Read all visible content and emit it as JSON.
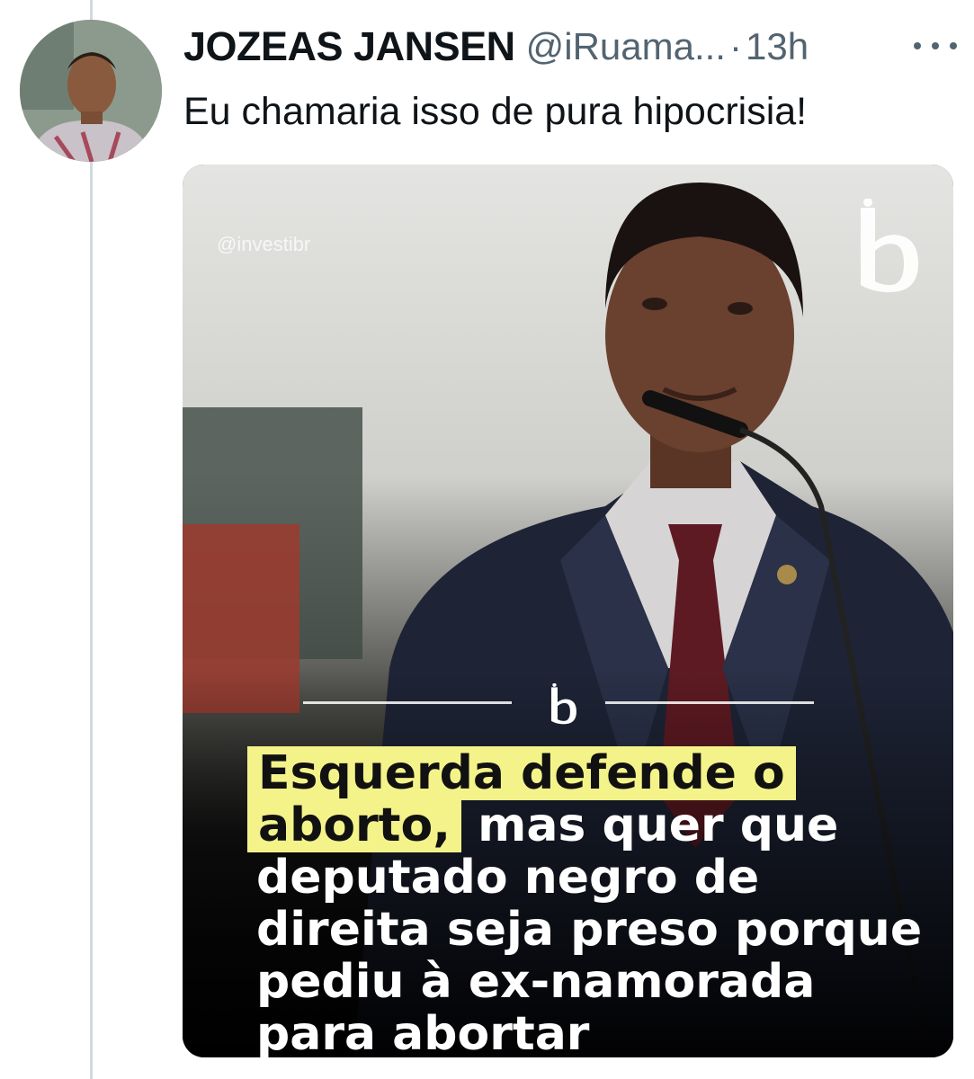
{
  "tweet": {
    "display_name": "JOZEAS JANSEN",
    "handle": "@iRuama...",
    "separator": "·",
    "time": "13h",
    "text": "Eu chamaria isso de pura hipocrisia!"
  },
  "media": {
    "watermark": "@investibr",
    "headline": {
      "line1_highlight": "Esquerda defende o",
      "line2_highlight": "aborto,",
      "line2_rest": " mas quer que",
      "line3": "deputado negro de",
      "line4": "direita seja preso porque",
      "line5": "pediu à ex-namorada",
      "line6": "para abortar"
    }
  },
  "colors": {
    "text_primary": "#0f1419",
    "text_secondary": "#536471",
    "thread_line": "#cfd9de",
    "highlight": "#f4f38a"
  },
  "icons": [
    "more-icon",
    "brand-logo",
    "mini-logo"
  ]
}
